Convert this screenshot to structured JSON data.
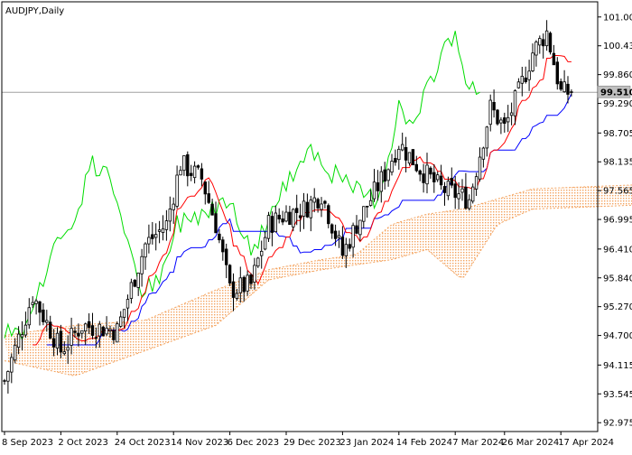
{
  "chart_data": {
    "type": "candlestick",
    "title": "AUDJPY,Daily",
    "symbol": "AUDJPY",
    "timeframe": "Daily",
    "current_price": 99.51,
    "current_price_label": "99.510",
    "ylim": [
      92.8,
      101.3
    ],
    "y_ticks": [
      "101.000",
      "100.430",
      "99.860",
      "99.290",
      "98.705",
      "98.135",
      "97.565",
      "96.995",
      "96.410",
      "95.840",
      "95.270",
      "94.700",
      "94.115",
      "93.545",
      "92.975"
    ],
    "x_ticks": [
      "8 Sep 2023",
      "2 Oct 2023",
      "24 Oct 2023",
      "14 Nov 2023",
      "6 Dec 2023",
      "29 Dec 2023",
      "23 Jan 2024",
      "14 Feb 2024",
      "7 Mar 2024",
      "26 Mar 2024",
      "17 Apr 2024"
    ],
    "x_tick_index": [
      0,
      16,
      32,
      48,
      64,
      80,
      96,
      112,
      128,
      142,
      158
    ],
    "bars_total": 162,
    "indicator": "Ichimoku Kinko Hyo",
    "colors": {
      "candle": "#000000",
      "tenkan": "#ff0000",
      "kijun": "#0000ff",
      "chikou": "#00dd00",
      "kumo": "#f4a460",
      "price_line": "#a0a0a0",
      "axis": "#000000",
      "background": "#ffffff"
    },
    "close_anchors": [
      [
        0,
        93.8
      ],
      [
        8,
        95.5
      ],
      [
        16,
        94.4
      ],
      [
        22,
        94.9
      ],
      [
        32,
        94.8
      ],
      [
        40,
        96.5
      ],
      [
        46,
        96.9
      ],
      [
        50,
        98.1
      ],
      [
        56,
        97.8
      ],
      [
        60,
        96.9
      ],
      [
        64,
        95.6
      ],
      [
        70,
        95.7
      ],
      [
        75,
        96.9
      ],
      [
        80,
        97.1
      ],
      [
        85,
        97.2
      ],
      [
        90,
        97.5
      ],
      [
        96,
        96.3
      ],
      [
        100,
        96.9
      ],
      [
        108,
        97.9
      ],
      [
        112,
        98.5
      ],
      [
        118,
        98.0
      ],
      [
        124,
        97.6
      ],
      [
        128,
        97.5
      ],
      [
        132,
        97.4
      ],
      [
        138,
        99.2
      ],
      [
        142,
        98.8
      ],
      [
        146,
        99.5
      ],
      [
        150,
        100.3
      ],
      [
        154,
        100.7
      ],
      [
        158,
        99.5
      ],
      [
        161,
        99.51
      ]
    ],
    "kumo_a_anchors": [
      [
        0,
        94.7
      ],
      [
        20,
        94.9
      ],
      [
        40,
        95.0
      ],
      [
        60,
        95.6
      ],
      [
        75,
        96.0
      ],
      [
        90,
        96.2
      ],
      [
        100,
        96.3
      ],
      [
        110,
        96.9
      ],
      [
        120,
        97.1
      ],
      [
        130,
        97.2
      ],
      [
        140,
        97.4
      ],
      [
        150,
        97.6
      ],
      [
        187,
        97.7
      ]
    ],
    "kumo_b_anchors": [
      [
        0,
        94.2
      ],
      [
        20,
        93.9
      ],
      [
        40,
        94.4
      ],
      [
        60,
        94.9
      ],
      [
        75,
        95.8
      ],
      [
        90,
        96.0
      ],
      [
        100,
        96.1
      ],
      [
        110,
        96.2
      ],
      [
        120,
        96.4
      ],
      [
        130,
        95.8
      ],
      [
        140,
        96.9
      ],
      [
        150,
        97.2
      ],
      [
        187,
        97.3
      ]
    ]
  }
}
